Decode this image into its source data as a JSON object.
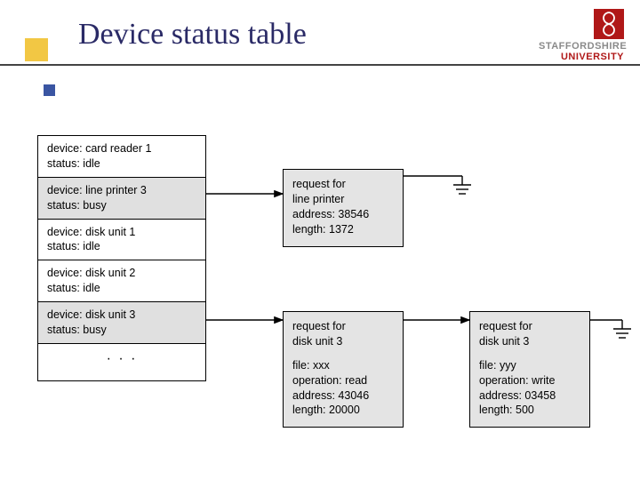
{
  "header": {
    "title": "Device status table",
    "logo_line1": "STAFFORDSHIRE",
    "logo_line2": "UNIVERSITY"
  },
  "devices": [
    {
      "name": "card reader 1",
      "status": "idle",
      "busy": false
    },
    {
      "name": "line printer 3",
      "status": "busy",
      "busy": true
    },
    {
      "name": "disk unit 1",
      "status": "idle",
      "busy": false
    },
    {
      "name": "disk unit 2",
      "status": "idle",
      "busy": false
    },
    {
      "name": "disk unit 3",
      "status": "busy",
      "busy": true
    }
  ],
  "labels": {
    "device_prefix": "device: ",
    "status_prefix": "status: ",
    "request_prefix": "request for",
    "file_prefix": "file: ",
    "operation_prefix": "operation: ",
    "address_prefix": "address: ",
    "length_prefix": "length: "
  },
  "requests": {
    "printer": {
      "target": "line printer",
      "address": "38546",
      "length": "1372"
    },
    "disk_a": {
      "target": "disk unit 3",
      "file": "xxx",
      "operation": "read",
      "address": "43046",
      "length": "20000"
    },
    "disk_b": {
      "target": "disk unit 3",
      "file": "yyy",
      "operation": "write",
      "address": "03458",
      "length": "500"
    }
  }
}
